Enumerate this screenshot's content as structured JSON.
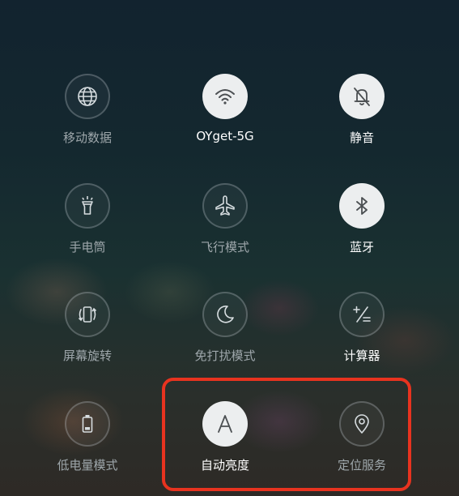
{
  "tiles": [
    {
      "label": "移动数据",
      "icon": "globe-icon",
      "active": false
    },
    {
      "label": "OYget-5G",
      "icon": "wifi-icon",
      "active": true
    },
    {
      "label": "静音",
      "icon": "bell-muted-icon",
      "active": true
    },
    {
      "label": "手电筒",
      "icon": "flashlight-icon",
      "active": false
    },
    {
      "label": "飞行模式",
      "icon": "airplane-icon",
      "active": false
    },
    {
      "label": "蓝牙",
      "icon": "bluetooth-icon",
      "active": true
    },
    {
      "label": "屏幕旋转",
      "icon": "screen-rotate-icon",
      "active": false
    },
    {
      "label": "免打扰模式",
      "icon": "moon-icon",
      "active": false
    },
    {
      "label": "计算器",
      "icon": "calculator-icon",
      "active": false
    },
    {
      "label": "低电量模式",
      "icon": "battery-icon",
      "active": false
    },
    {
      "label": "自动亮度",
      "icon": "auto-brightness-icon",
      "active": true
    },
    {
      "label": "定位服务",
      "icon": "location-pin-icon",
      "active": false
    }
  ],
  "colors": {
    "highlight_border": "#e8331f",
    "active_circle": "#eceeef",
    "inactive_label": "#9ea7ab",
    "active_label": "#ffffff"
  }
}
